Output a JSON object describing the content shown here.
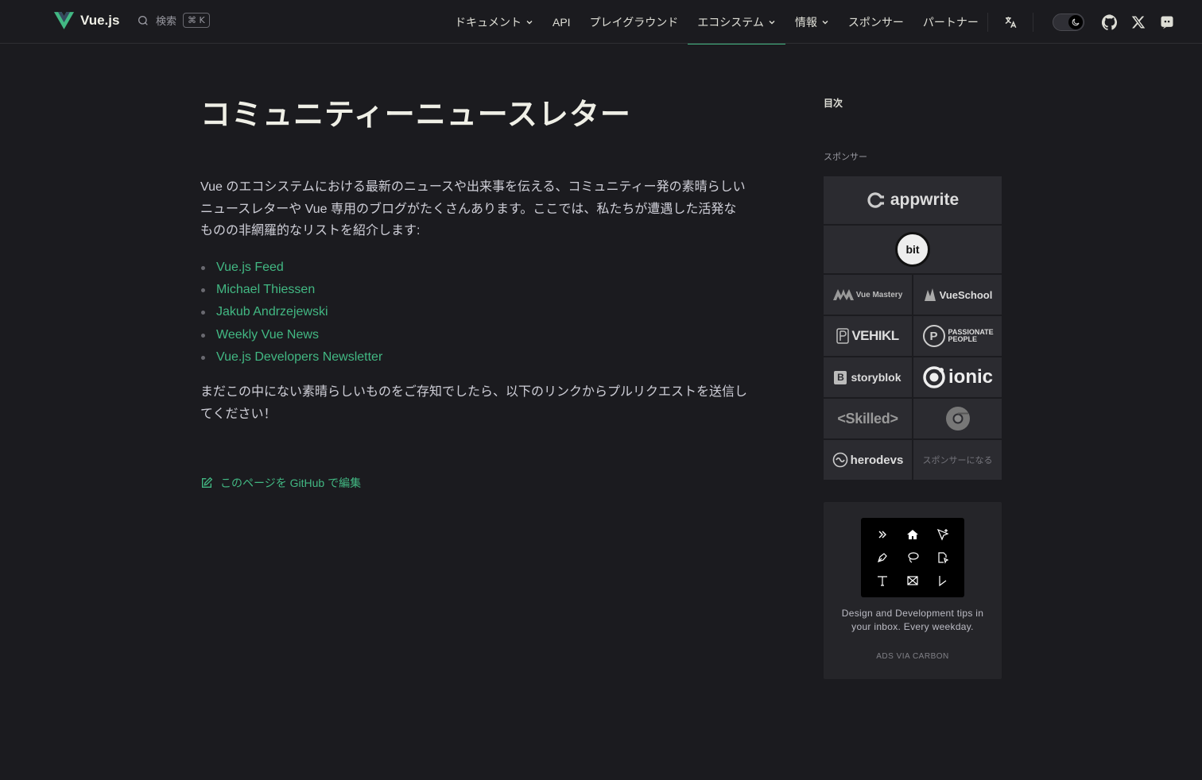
{
  "nav": {
    "logo_text": "Vue.js",
    "search_label": "検索",
    "search_shortcut": "⌘ K",
    "items": [
      {
        "label": "ドキュメント",
        "dropdown": true,
        "active": false
      },
      {
        "label": "API",
        "dropdown": false,
        "active": false
      },
      {
        "label": "プレイグラウンド",
        "dropdown": false,
        "active": false
      },
      {
        "label": "エコシステム",
        "dropdown": true,
        "active": true
      },
      {
        "label": "情報",
        "dropdown": true,
        "active": false
      },
      {
        "label": "スポンサー",
        "dropdown": false,
        "active": false
      },
      {
        "label": "パートナー",
        "dropdown": false,
        "active": false
      }
    ],
    "icons": [
      "translate-icon",
      "moon-icon",
      "github-icon",
      "x-icon",
      "discord-icon"
    ]
  },
  "main": {
    "title": "コミュニティーニュースレター",
    "intro": "Vue のエコシステムにおける最新のニュースや出来事を伝える、コミュニティー発の素晴らしいニュースレターや Vue 専用のブログがたくさんあります。ここでは、私たちが遭遇した活発なものの非網羅的なリストを紹介します:",
    "links": [
      "Vue.js Feed",
      "Michael Thiessen",
      "Jakub Andrzejewski",
      "Weekly Vue News",
      "Vue.js Developers Newsletter"
    ],
    "outro": "まだこの中にない素晴らしいものをご存知でしたら、以下のリンクからプルリクエストを送信してください！",
    "edit_link": "このページを GitHub で編集"
  },
  "aside": {
    "toc_title": "目次",
    "sponsor_title": "スポンサー",
    "sponsors": {
      "appwrite": "appwrite",
      "bit": "bit",
      "vue_mastery": "Vue Mastery",
      "vue_school": "VueSchool",
      "vehikl": "VEHIKL",
      "passionate_people": "PASSIONATE PEOPLE",
      "storyblok": "storyblok",
      "ionic": "ionic",
      "skilled": "<Skilled>",
      "herodevs": "herodevs",
      "become_sponsor": "スポンサーになる"
    },
    "ad": {
      "text": "Design and Development tips in your inbox. Every weekday.",
      "via": "ADS VIA CARBON"
    }
  },
  "colors": {
    "brand": "#42b883",
    "background": "#1b1b1f",
    "sponsor_bg": "#2b2b30"
  }
}
